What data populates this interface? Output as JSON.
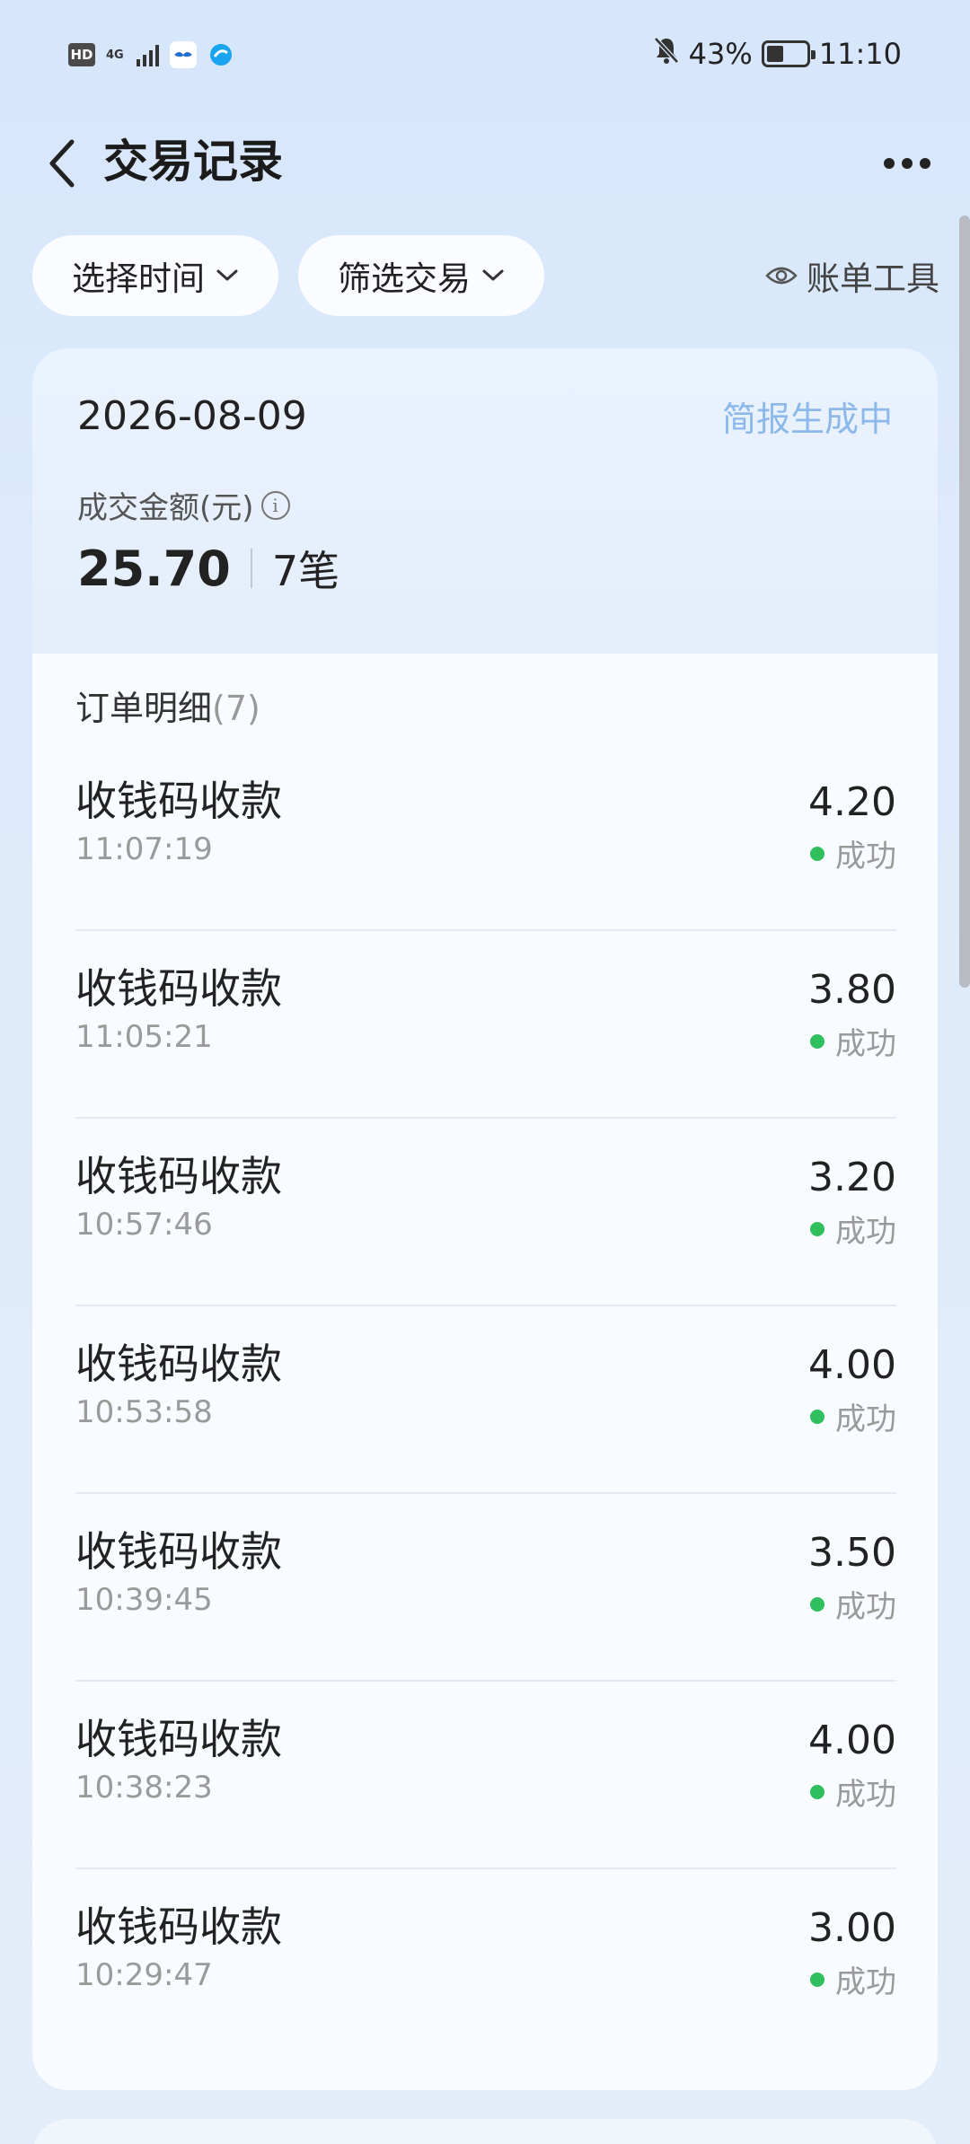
{
  "status_bar": {
    "hd": "HD",
    "network": "4G",
    "battery_percent": "43%",
    "battery_level": 0.43,
    "time": "11:10",
    "icons": [
      "hd-icon",
      "signal-icon",
      "app-bird-icon",
      "app-browser-icon",
      "bell-muted-icon",
      "battery-icon"
    ]
  },
  "header": {
    "title": "交易记录"
  },
  "filters": {
    "time_label": "选择时间",
    "filter_label": "筛选交易",
    "bill_tools_label": "账单工具"
  },
  "summary": {
    "date": "2026-08-09",
    "brief_status": "简报生成中",
    "amount_label": "成交金额(元)",
    "amount": "25.70",
    "count": "7笔"
  },
  "orders": {
    "header": "订单明细",
    "count": "(7)",
    "items": [
      {
        "title": "收钱码收款",
        "time": "11:07:19",
        "amount": "4.20",
        "status": "成功"
      },
      {
        "title": "收钱码收款",
        "time": "11:05:21",
        "amount": "3.80",
        "status": "成功"
      },
      {
        "title": "收钱码收款",
        "time": "10:57:46",
        "amount": "3.20",
        "status": "成功"
      },
      {
        "title": "收钱码收款",
        "time": "10:53:58",
        "amount": "4.00",
        "status": "成功"
      },
      {
        "title": "收钱码收款",
        "time": "10:39:45",
        "amount": "3.50",
        "status": "成功"
      },
      {
        "title": "收钱码收款",
        "time": "10:38:23",
        "amount": "4.00",
        "status": "成功"
      },
      {
        "title": "收钱码收款",
        "time": "10:29:47",
        "amount": "3.00",
        "status": "成功"
      }
    ]
  },
  "colors": {
    "accent_light": "#8cb8ea",
    "success": "#2fbf5d",
    "background": "#d6e6fb"
  }
}
